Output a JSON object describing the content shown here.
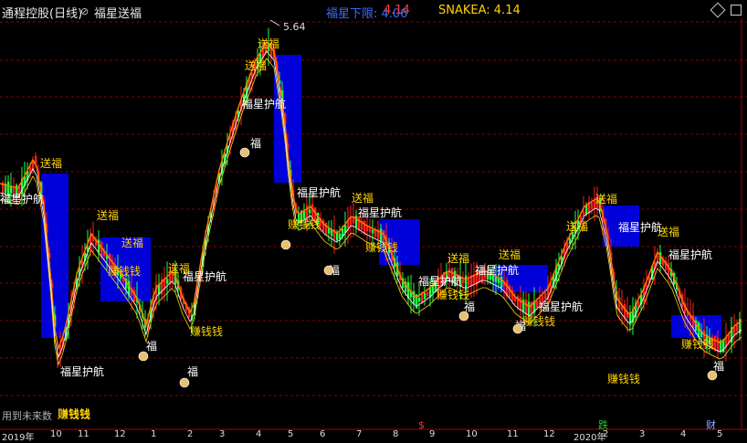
{
  "header": {
    "stock_title": "通程控股(日线)",
    "dropdown_icon": "⊘",
    "indicator_name": "福星送福",
    "fx_label": "福星下限: 4.06",
    "fx_value": "4.14",
    "snake": "SNAKEA: 4.14"
  },
  "chart_labels": {
    "max_price": "5.64",
    "footer_text": "用到未来数",
    "earn": "赚钱钱"
  },
  "annotations": [
    {
      "text": "送福",
      "color": "#ffd400"
    },
    {
      "text": "福星护航",
      "color": "#ffffff"
    },
    {
      "text": "赚钱钱",
      "color": "#ffd400"
    },
    {
      "text": "福",
      "color": "#ffffff"
    },
    {
      "text": "$",
      "color": "#ff3333"
    },
    {
      "text": "跌",
      "color": "#22cc22"
    },
    {
      "text": "财",
      "color": "#8fb0ff"
    }
  ],
  "x_ticks": [
    "2019年",
    "10",
    "11",
    "12",
    "1",
    "2",
    "3",
    "4",
    "5",
    "6",
    "7",
    "8",
    "9",
    "10",
    "11",
    "12",
    "2020年",
    "2",
    "3",
    "4",
    "5"
  ],
  "colors": {
    "up": "#ff2020",
    "down": "#22ff44",
    "ma": "#ff7a00",
    "band": "#0000ff",
    "line": "#ffd400",
    "bg": "#000000",
    "grid": "#8a0000"
  }
}
